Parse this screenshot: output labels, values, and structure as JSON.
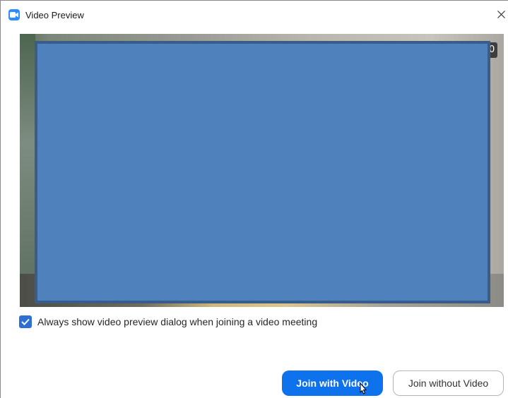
{
  "window": {
    "title": "Video Preview",
    "app_icon": "video-camera-icon",
    "close_icon": "close-icon"
  },
  "preview": {
    "corner_badge": "0",
    "redaction_color": "#4f81bd"
  },
  "options": {
    "always_show_label": "Always show video preview dialog when joining a video meeting",
    "always_show_checked": true
  },
  "actions": {
    "join_with_video": "Join with Video",
    "join_without_video": "Join without Video"
  },
  "colors": {
    "accent": "#0e72ed",
    "checkbox": "#2d6fd2"
  }
}
